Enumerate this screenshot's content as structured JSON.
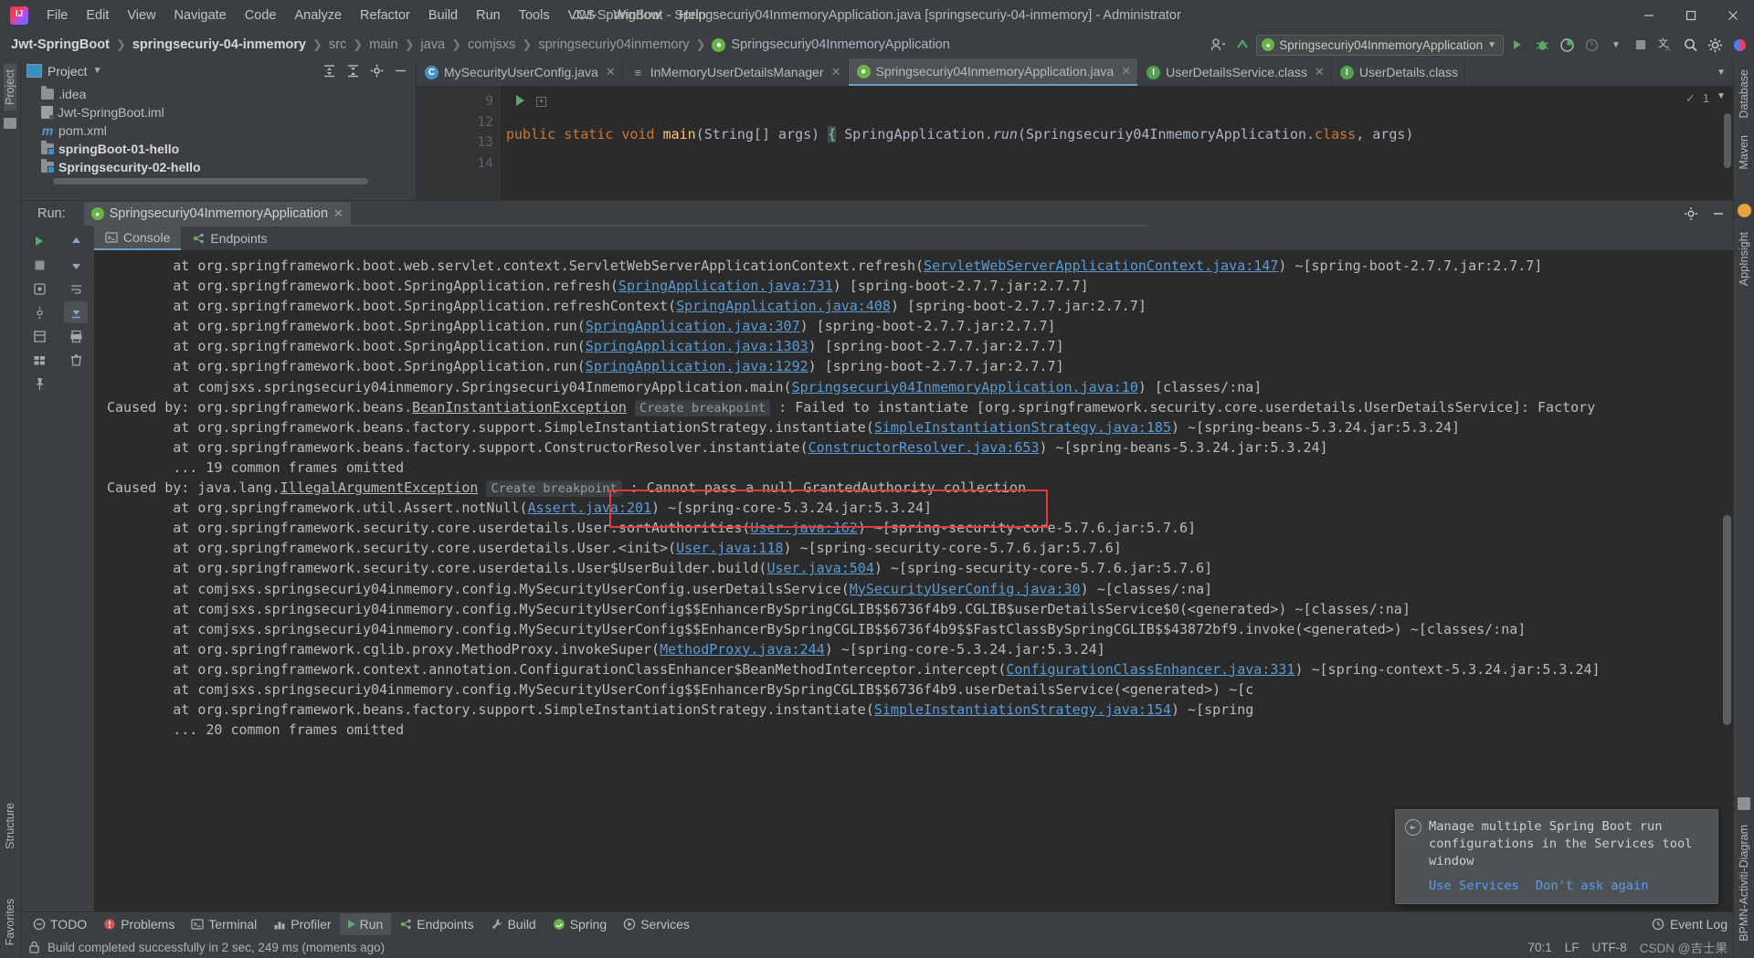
{
  "window": {
    "title": "Jwt-SpringBoot - Springsecuriy04InmemoryApplication.java [springsecuriy-04-inmemory] - Administrator",
    "minimize": "—",
    "maximize": "❐",
    "close": "✕"
  },
  "menu": [
    "File",
    "Edit",
    "View",
    "Navigate",
    "Code",
    "Analyze",
    "Refactor",
    "Build",
    "Run",
    "Tools",
    "VCS",
    "Window",
    "Help"
  ],
  "breadcrumb": [
    {
      "label": "Jwt-SpringBoot",
      "bold": true
    },
    {
      "label": "springsecuriy-04-inmemory",
      "bold": true
    },
    {
      "label": "src",
      "bold": false
    },
    {
      "label": "main",
      "bold": false
    },
    {
      "label": "java",
      "bold": false
    },
    {
      "label": "comjsxs",
      "bold": false
    },
    {
      "label": "springsecuriy04inmemory",
      "bold": false
    },
    {
      "label": "Springsecuriy04InmemoryApplication",
      "bold": false
    }
  ],
  "toolbar": {
    "run_config": "Springsecuriy04InmemoryApplication",
    "run_tooltip": "Run",
    "debug_tooltip": "Debug",
    "coverage_tooltip": "Run with Coverage",
    "profiler_tooltip": "Profiler",
    "stop_tooltip": "Stop",
    "translate_tooltip": "Translate",
    "search_tooltip": "Search Everywhere",
    "settings_tooltip": "Settings"
  },
  "project": {
    "title": "Project",
    "items": [
      {
        "label": ".idea",
        "icon": "folder-icon",
        "bold": false,
        "indent": 0
      },
      {
        "label": "Jwt-SpringBoot.iml",
        "icon": "iml-file-icon",
        "bold": false,
        "indent": 0
      },
      {
        "label": "pom.xml",
        "icon": "maven-icon",
        "bold": false,
        "indent": 0
      },
      {
        "label": "springBoot-01-hello",
        "icon": "module-folder-icon",
        "bold": true,
        "indent": 0
      },
      {
        "label": "Springsecurity-02-hello",
        "icon": "module-folder-icon",
        "bold": true,
        "indent": 0
      }
    ]
  },
  "left_tool_tabs": [
    "Project",
    "Structure",
    "Favorites"
  ],
  "right_tool_tabs": [
    "Database",
    "Maven",
    "AppInsight",
    "BPMN-Activiti-Diagram"
  ],
  "editor": {
    "tabs": [
      {
        "label": "MySecurityUserConfig.java",
        "icon": "class-icon",
        "active": false
      },
      {
        "label": "InMemoryUserDetailsManager",
        "icon": "manager-icon",
        "active": false
      },
      {
        "label": "Springsecuriy04InmemoryApplication.java",
        "icon": "spring-boot-icon",
        "active": true
      },
      {
        "label": "UserDetailsService.class",
        "icon": "interface-icon",
        "active": false
      },
      {
        "label": "UserDetails.class",
        "icon": "interface-icon",
        "active": false
      }
    ],
    "lines": [
      {
        "num": "9",
        "run_gutter": true,
        "fold": true,
        "code": "public static void main(String[] args) { SpringApplication.run(Springsecuriy04InmemoryApplication.class, args)"
      },
      {
        "num": "12",
        "run_gutter": false,
        "fold": false,
        "code": ""
      },
      {
        "num": "13",
        "run_gutter": false,
        "fold": false,
        "code": "    }"
      },
      {
        "num": "14",
        "run_gutter": false,
        "fold": false,
        "code": ""
      }
    ],
    "inspection_count": "1"
  },
  "run_window": {
    "label": "Run:",
    "tab": "Springsecuriy04InmemoryApplication",
    "tab_close": "✕",
    "console_tabs": [
      {
        "label": "Console",
        "active": true,
        "icon": "console-icon"
      },
      {
        "label": "Endpoints",
        "active": false,
        "icon": "endpoints-icon"
      }
    ],
    "console_lines": [
      {
        "t": "        at org.springframework.boot.web.servlet.context.ServletWebServerApplicationContext.refresh(",
        "l": "ServletWebServerApplicationContext.java:147",
        "t2": ") ~[spring-boot-2.7.7.jar:2.7.7]"
      },
      {
        "t": "        at org.springframework.boot.SpringApplication.refresh(",
        "l": "SpringApplication.java:731",
        "t2": ") [spring-boot-2.7.7.jar:2.7.7]"
      },
      {
        "t": "        at org.springframework.boot.SpringApplication.refreshContext(",
        "l": "SpringApplication.java:408",
        "t2": ") [spring-boot-2.7.7.jar:2.7.7]"
      },
      {
        "t": "        at org.springframework.boot.SpringApplication.run(",
        "l": "SpringApplication.java:307",
        "t2": ") [spring-boot-2.7.7.jar:2.7.7]"
      },
      {
        "t": "        at org.springframework.boot.SpringApplication.run(",
        "l": "SpringApplication.java:1303",
        "t2": ") [spring-boot-2.7.7.jar:2.7.7]"
      },
      {
        "t": "        at org.springframework.boot.SpringApplication.run(",
        "l": "SpringApplication.java:1292",
        "t2": ") [spring-boot-2.7.7.jar:2.7.7]"
      },
      {
        "t": "        at comjsxs.springsecuriy04inmemory.Springsecuriy04InmemoryApplication.main(",
        "l": "Springsecuriy04InmemoryApplication.java:10",
        "t2": ") [classes/:na]"
      },
      {
        "caused": true,
        "pre": "Caused by: org.springframework.beans.",
        "exc": "BeanInstantiationException",
        "bp": "Create breakpoint",
        "post": " : Failed to instantiate [org.springframework.security.core.userdetails.UserDetailsService]: Factory"
      },
      {
        "t": "        at org.springframework.beans.factory.support.SimpleInstantiationStrategy.instantiate(",
        "l": "SimpleInstantiationStrategy.java:185",
        "t2": ") ~[spring-beans-5.3.24.jar:5.3.24]"
      },
      {
        "t": "        at org.springframework.beans.factory.support.ConstructorResolver.instantiate(",
        "l": "ConstructorResolver.java:653",
        "t2": ") ~[spring-beans-5.3.24.jar:5.3.24]"
      },
      {
        "t": "        ... 19 common frames omitted",
        "l": "",
        "t2": ""
      },
      {
        "caused": true,
        "pre": "Caused by: java.lang.",
        "exc": "IllegalArgumentException",
        "bp": "Create breakpoint",
        "post": " : Cannot pass a null GrantedAuthority collection"
      },
      {
        "t": "        at org.springframework.util.Assert.notNull(",
        "l": "Assert.java:201",
        "t2": ") ~[spring-core-5.3.24.jar:5.3.24]"
      },
      {
        "t": "        at org.springframework.security.core.userdetails.User.sortAuthorities(",
        "l": "User.java:162",
        "t2": ") ~[spring-security-core-5.7.6.jar:5.7.6]"
      },
      {
        "t": "        at org.springframework.security.core.userdetails.User.<init>(",
        "l": "User.java:118",
        "t2": ") ~[spring-security-core-5.7.6.jar:5.7.6]"
      },
      {
        "t": "        at org.springframework.security.core.userdetails.User$UserBuilder.build(",
        "l": "User.java:504",
        "t2": ") ~[spring-security-core-5.7.6.jar:5.7.6]"
      },
      {
        "t": "        at comjsxs.springsecuriy04inmemory.config.MySecurityUserConfig.userDetailsService(",
        "l": "MySecurityUserConfig.java:30",
        "t2": ") ~[classes/:na]"
      },
      {
        "t": "        at comjsxs.springsecuriy04inmemory.config.MySecurityUserConfig$$EnhancerBySpringCGLIB$$6736f4b9.CGLIB$userDetailsService$0(<generated>) ~[classes/:na]",
        "l": "",
        "t2": ""
      },
      {
        "t": "        at comjsxs.springsecuriy04inmemory.config.MySecurityUserConfig$$EnhancerBySpringCGLIB$$6736f4b9$$FastClassBySpringCGLIB$$43872bf9.invoke(<generated>) ~[classes/:na]",
        "l": "",
        "t2": ""
      },
      {
        "t": "        at org.springframework.cglib.proxy.MethodProxy.invokeSuper(",
        "l": "MethodProxy.java:244",
        "t2": ") ~[spring-core-5.3.24.jar:5.3.24]"
      },
      {
        "t": "        at org.springframework.context.annotation.ConfigurationClassEnhancer$BeanMethodInterceptor.intercept(",
        "l": "ConfigurationClassEnhancer.java:331",
        "t2": ") ~[spring-context-5.3.24.jar:5.3.24]"
      },
      {
        "t": "        at comjsxs.springsecuriy04inmemory.config.MySecurityUserConfig$$EnhancerBySpringCGLIB$$6736f4b9.userDetailsService(<generated>) ~[c",
        "l": "",
        "t2": ""
      },
      {
        "t": "        at org.springframework.beans.factory.support.SimpleInstantiationStrategy.instantiate(",
        "l": "SimpleInstantiationStrategy.java:154",
        "t2": ") ~[spring"
      },
      {
        "t": "        ... 20 common frames omitted",
        "l": "",
        "t2": ""
      }
    ],
    "highlight_message": "Cannot pass a null GrantedAuthority collection",
    "highlight_color": "#e03c3c"
  },
  "notification": {
    "icon": "spring-run-icon",
    "message": "Manage multiple Spring Boot run configurations in the Services tool window",
    "actions": [
      "Use Services",
      "Don't ask again"
    ]
  },
  "bottom_bar": {
    "items": [
      {
        "label": "TODO",
        "icon": "todo-icon",
        "active": false
      },
      {
        "label": "Problems",
        "icon": "problems-icon",
        "active": false
      },
      {
        "label": "Terminal",
        "icon": "terminal-icon",
        "active": false
      },
      {
        "label": "Profiler",
        "icon": "profiler-icon",
        "active": false
      },
      {
        "label": "Run",
        "icon": "run-icon",
        "active": true
      },
      {
        "label": "Endpoints",
        "icon": "endpoints-icon",
        "active": false
      },
      {
        "label": "Build",
        "icon": "build-icon",
        "active": false
      },
      {
        "label": "Spring",
        "icon": "spring-icon",
        "active": false
      },
      {
        "label": "Services",
        "icon": "services-icon",
        "active": false
      }
    ],
    "event_log": "Event Log"
  },
  "status_bar": {
    "message": "Build completed successfully in 2 sec, 249 ms (moments ago)",
    "caret": "70:1",
    "line_sep": "LF",
    "encoding": "UTF-8",
    "watermark": "CSDN @吉士果",
    "lock_icon": "lock-icon"
  }
}
